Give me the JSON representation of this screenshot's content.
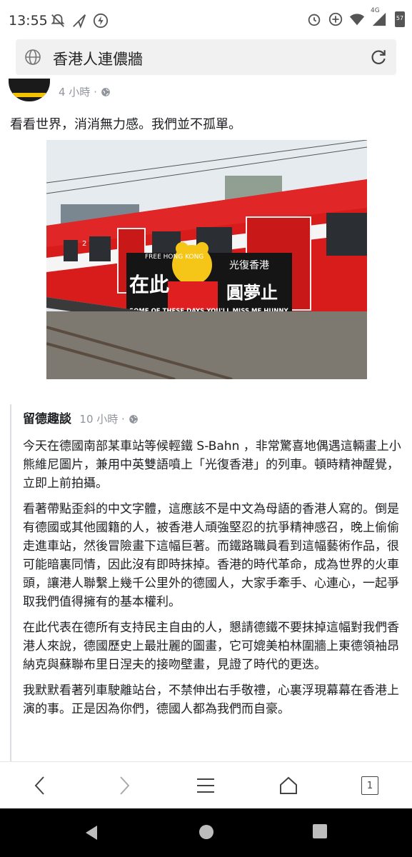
{
  "status": {
    "time": "13:55",
    "network": "4G",
    "battery": "57"
  },
  "browser": {
    "address": "香港人連儂牆",
    "tab_count": "1"
  },
  "post": {
    "time": "4 小時 ·",
    "text": "看看世界，消消無力感。我們並不孤單。"
  },
  "photo": {
    "banner_top_left": "FREE HONG KONG",
    "banner_top_right": "光復香港",
    "banner_left": "在此",
    "banner_right": "圓夢止",
    "banner_bottom": "SOME OF THESE DAYS YOU'LL MISS ME HUNNY ...",
    "car_number": "2"
  },
  "shared": {
    "author": "留德趣談",
    "time": "10 小時 ·",
    "paragraphs": [
      "今天在德國南部某車站等候輕鐵 S-Bahn ，非常驚喜地偶遇這輛畫上小熊維尼圖片，兼用中英雙語噴上「光復香港」的列車。頓時精神醒覺，立即上前拍攝。",
      "看著帶點歪斜的中文字體，這應該不是中文為母語的香港人寫的。倒是有德國或其他國籍的人，被香港人頑強堅忍的抗爭精神感召，晚上偷偷走進車站，然後冒險畫下這幅巨著。而鐵路職員看到這幅藝術作品，很可能暗裏同情，因此沒有即時抹掉。香港的時代革命，成為世界的火車頭，讓港人聯繫上幾千公里外的德國人，大家手牽手、心連心，一起爭取我們值得擁有的基本權利。",
      "在此代表在德所有支持民主自由的人，懇請德鐵不要抹掉這幅對我們香港人來說，德國歷史上最壯麗的圖畫，它可媲美柏林圍牆上東德領袖昂納克與蘇聯布里日涅夫的接吻壁畫，見證了時代的更迭。",
      "我默默看著列車駛離站台，不禁伸出右手敬禮，心裏浮現幕幕在香港上演的事。正是因為你們，德國人都為我們而自豪。"
    ]
  }
}
